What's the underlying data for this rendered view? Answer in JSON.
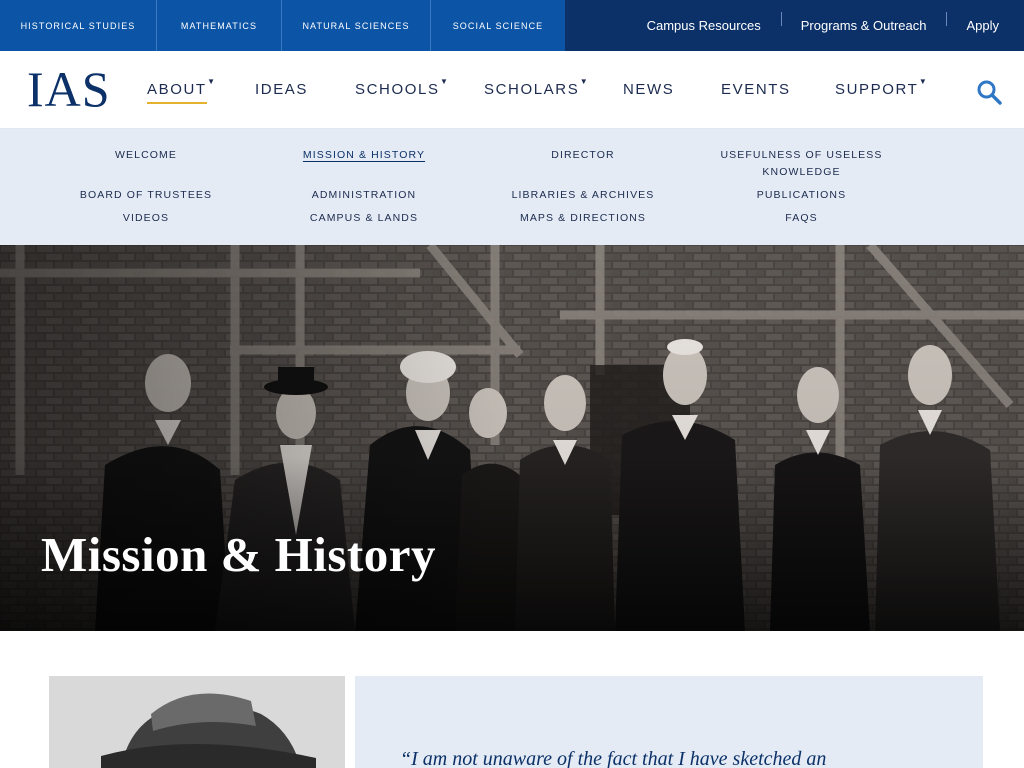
{
  "school_links": [
    "Historical Studies",
    "Mathematics",
    "Natural Sciences",
    "Social Science"
  ],
  "utility_links": [
    "Campus Resources",
    "Programs & Outreach",
    "Apply"
  ],
  "logo": "IAS",
  "nav": {
    "items": [
      {
        "label": "About",
        "has_dropdown": true,
        "active": true
      },
      {
        "label": "Ideas",
        "has_dropdown": false
      },
      {
        "label": "Schools",
        "has_dropdown": true
      },
      {
        "label": "Scholars",
        "has_dropdown": true
      },
      {
        "label": "News",
        "has_dropdown": false
      },
      {
        "label": "Events",
        "has_dropdown": false
      },
      {
        "label": "Support",
        "has_dropdown": true
      }
    ],
    "caret_glyph": "▼",
    "search_icon": "search-icon"
  },
  "submenu": {
    "items": [
      "Welcome",
      "Mission & History",
      "Director",
      "Usefulness of Useless",
      "Knowledge",
      "Board of Trustees",
      "Administration",
      "Libraries & Archives",
      "Publications",
      "Videos",
      "Campus & Lands",
      "Maps & Directions",
      "FAQs"
    ],
    "current": "Mission & History"
  },
  "hero": {
    "title": "Mission & History"
  },
  "quote": {
    "text": "“I am not unaware of the fact that I have sketched an"
  },
  "colors": {
    "navy": "#0b3168",
    "school_blue": "#0c54a5",
    "accent_gold": "#e5b22f",
    "submenu_bg": "#e4ebf4",
    "search_blue": "#2f76c5"
  }
}
